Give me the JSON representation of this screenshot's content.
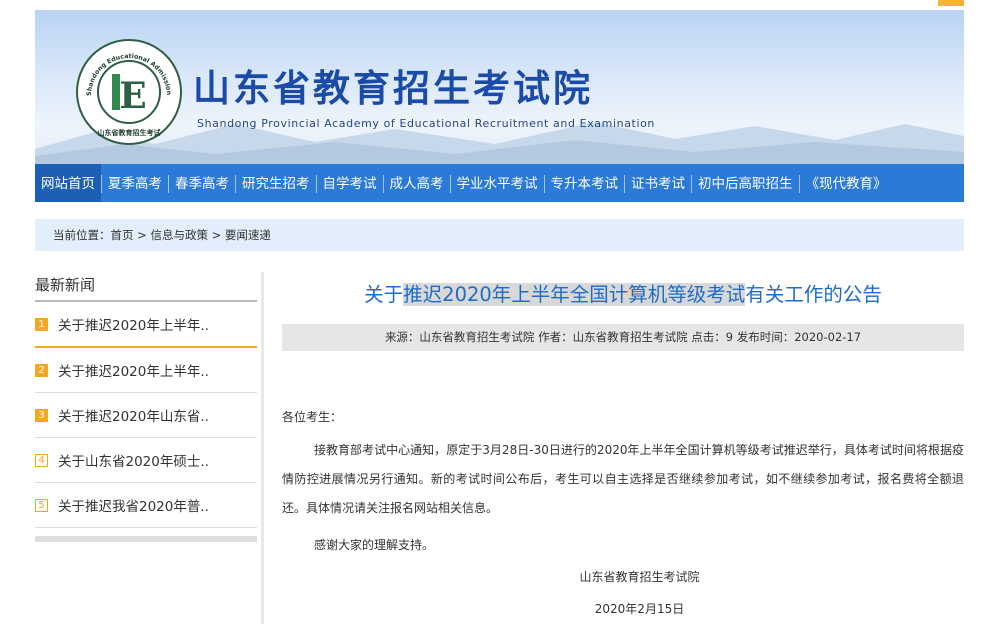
{
  "header": {
    "title": "山东省教育招生考试院",
    "subtitle": "Shandong Provincial Academy of Educational Recruitment and Examination",
    "logo_ring_text": "Shandong Educational Admission & Examinations",
    "logo_bottom_text": "山东省教育招生考试",
    "logo_letter": "E"
  },
  "nav": {
    "items": [
      {
        "label": "网站首页"
      },
      {
        "label": "夏季高考"
      },
      {
        "label": "春季高考"
      },
      {
        "label": "研究生招考"
      },
      {
        "label": "自学考试"
      },
      {
        "label": "成人高考"
      },
      {
        "label": "学业水平考试"
      },
      {
        "label": "专升本考试"
      },
      {
        "label": "证书考试"
      },
      {
        "label": "初中后高职招生"
      },
      {
        "label": "《现代教育》"
      }
    ]
  },
  "breadcrumb": {
    "text": "当前位置：首页 > 信息与政策 > 要闻速递"
  },
  "sidebar": {
    "title": "最新新闻",
    "items": [
      {
        "num": "1",
        "text": "关于推迟2020年上半年.."
      },
      {
        "num": "2",
        "text": "关于推迟2020年上半年.."
      },
      {
        "num": "3",
        "text": "关于推迟2020年山东省.."
      },
      {
        "num": "4",
        "text": "关于山东省2020年硕士.."
      },
      {
        "num": "5",
        "text": "关于推迟我省2020年普.."
      }
    ]
  },
  "article": {
    "title_prefix": "关于",
    "title_highlight": "推迟2020年上半年全国计算机等级考试",
    "title_suffix": "有关工作的公告",
    "meta": "来源：山东省教育招生考试院 作者：山东省教育招生考试院 点击：9 发布时间：2020-02-17",
    "greeting": "各位考生：",
    "paragraph": "接教育部考试中心通知，原定于3月28日-30日进行的2020年上半年全国计算机等级考试推迟举行，具体考试时间将根据疫情防控进展情况另行通知。新的考试时间公布后，考生可以自主选择是否继续参加考试，如不继续参加考试，报名费将全额退还。具体情况请关注报名网站相关信息。",
    "thanks": "感谢大家的理解支持。",
    "signature": "山东省教育招生考试院",
    "date": "2020年2月15日"
  },
  "colors": {
    "nav_bg": "#2b7ad6",
    "title_blue": "#1e6cc7",
    "accent_orange": "#f5a623"
  }
}
